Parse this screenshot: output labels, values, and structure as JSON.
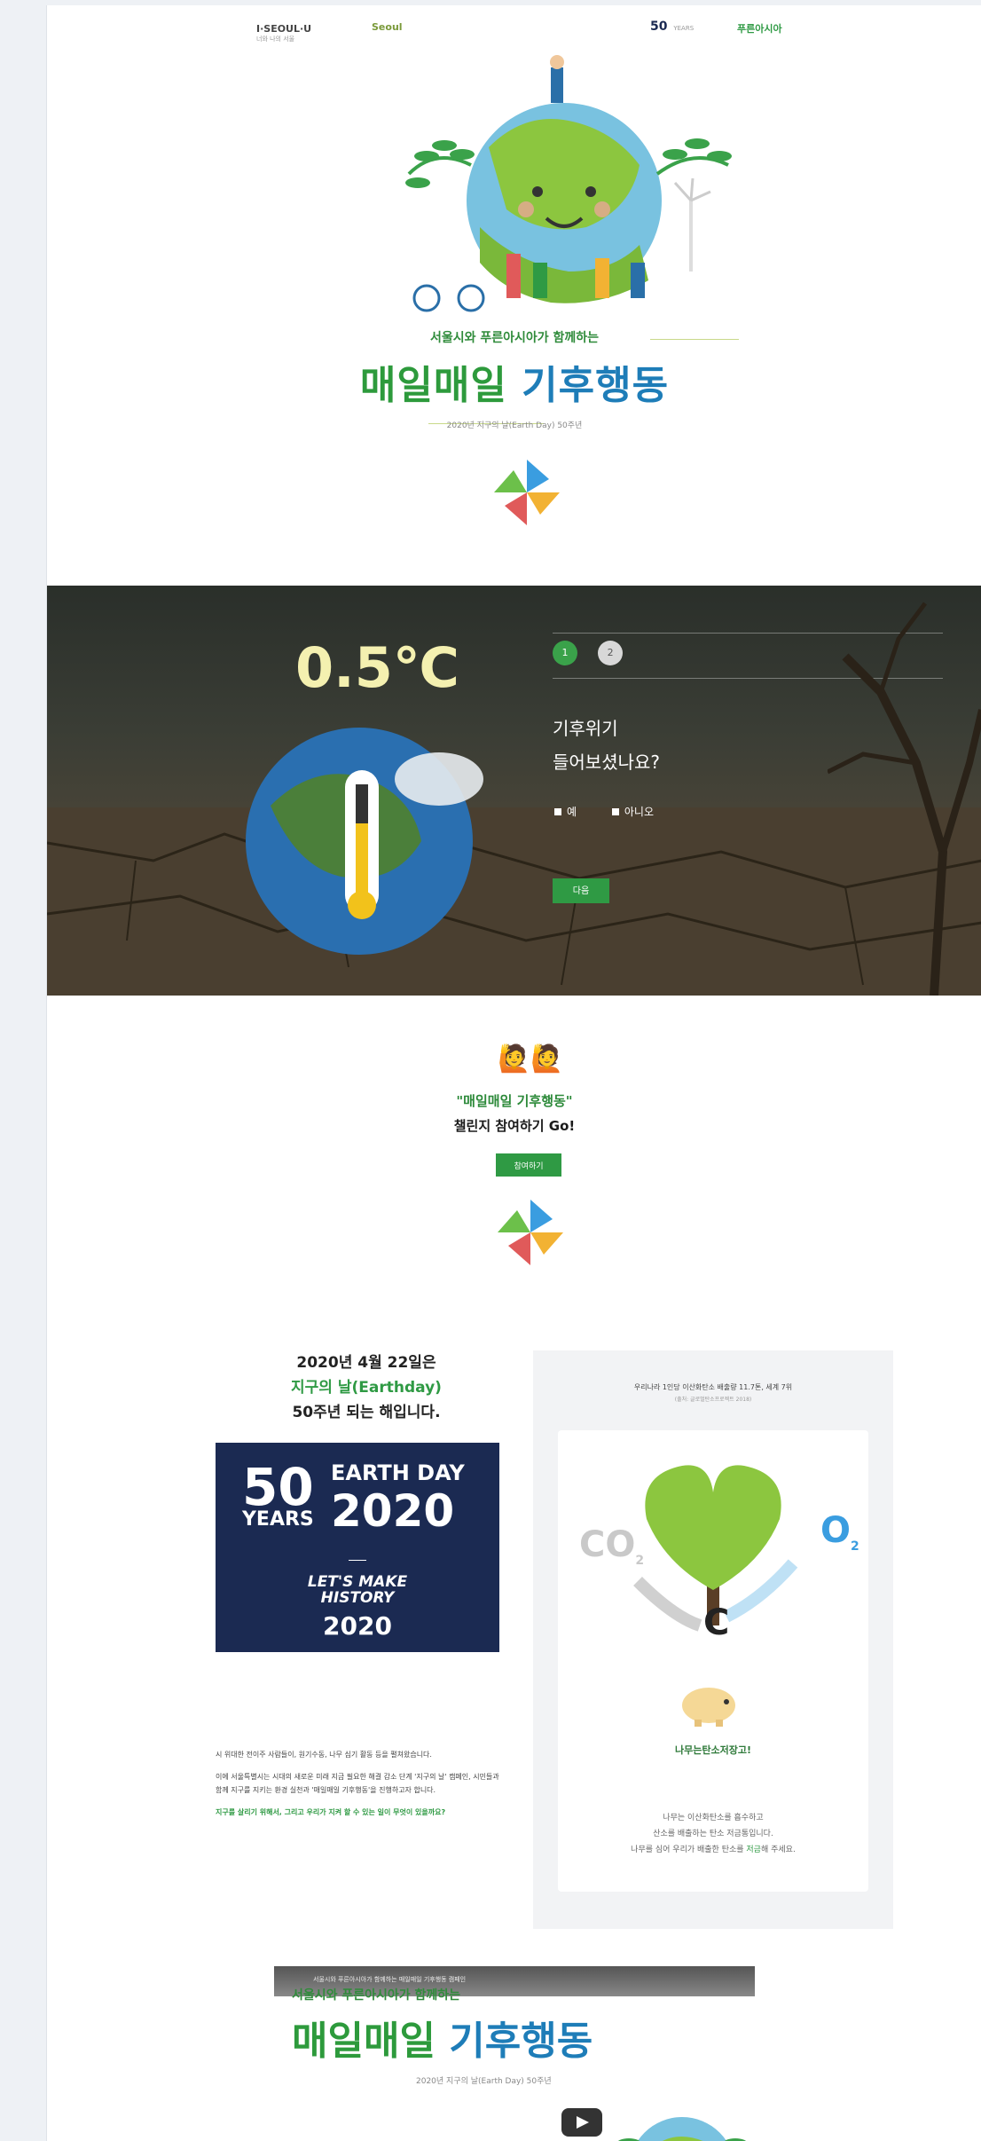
{
  "header": {
    "logo_seoul": "I·SEOUL·U",
    "logo_seoul_sub": "너와 나의 서울",
    "logo_seoul2": "Seoul",
    "logo_50": "50",
    "logo_50_sub": "YEARS",
    "logo_org": "푸른아시아"
  },
  "hero": {
    "subtitle": "서울시와 푸른아시아가 함께하는",
    "title_part1": "매일매일",
    "title_part2": "기후행동",
    "date": "2020년 지구의 날(Earth Day) 50주년"
  },
  "quiz": {
    "temperature": "0.5℃",
    "step1": "1",
    "step2": "2",
    "question_line1": "기후위기",
    "question_line2": "들어보셨나요?",
    "answer_yes": "예",
    "answer_no": "아니오",
    "next_label": "다음"
  },
  "challenge": {
    "emoji": "🙋🙋",
    "title": "\"매일매일 기후행동\"",
    "subtitle": "챌린지 참여하기 Go!",
    "go_label": "참여하기"
  },
  "earthday": {
    "line1": "2020년 4월 22일은",
    "line2": "지구의 날(Earthday)",
    "line3": "50주년 되는 해입니다.",
    "poster_50": "50",
    "poster_years": "YEARS",
    "poster_earthday": "EARTH DAY",
    "poster_2020": "2020",
    "poster_lets": "LET'S MAKE",
    "poster_history": "HISTORY",
    "poster_2020b": "2020",
    "text_dark": "시 위대한 전이주 사람들이, 원기수동, 나무 심기 활동 등을 펼쳐왔습니다.",
    "text_dark2": "이에 서울특별시는 시대의 새로운 미래 지금 필요한 해결 감소 단계 '지구의 날' 캠페인, 시민들과 함께 지구를 지키는 환경 실천과 '매일매일 기후행동'을 진행하고자 합니다.",
    "text_green": "지구를 살리기 위해서, 그리고 우리가 지켜 할 수 있는 일이 무엇이 있을까요?"
  },
  "carbon": {
    "title": "우리나라 1인당 이산화탄소 배출량 11.7톤, 세계 7위",
    "subtitle": "(출처: 글로벌탄소프로젝트 2018)",
    "co2": "CO",
    "o2": "O",
    "caption": "나무는탄소저장고!",
    "desc1": "나무는 이산화탄소를 흡수하고",
    "desc2": "산소를 배출하는 탄소 저금통입니다.",
    "desc3_a": "나무를 심어 우리가 배출한 탄소를 ",
    "desc3_b": "저금",
    "desc3_c": "해 주세요."
  },
  "video": {
    "bar_text": "서울시와 푸른아시아가 함께하는 매일매일 기후행동 캠페인",
    "subtitle": "서울시와 푸른아시아가 함께하는",
    "title_part1": "매일매일",
    "title_part2": "기후행동",
    "date": "2020년 지구의 날(Earth Day) 50주년"
  }
}
